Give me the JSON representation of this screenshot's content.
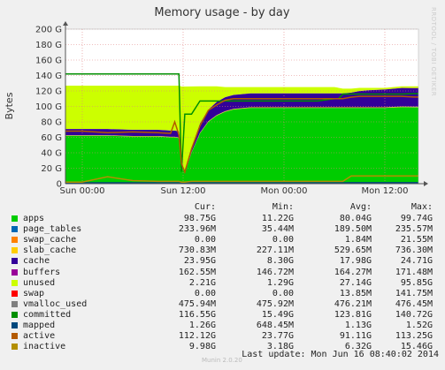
{
  "chart_data": {
    "type": "area",
    "title": "Memory usage - by day",
    "ylabel": "Bytes",
    "xlabel": "",
    "ylim": [
      0,
      200
    ],
    "y_unit": "G",
    "y_ticks": [
      "0",
      "20 G",
      "40 G",
      "60 G",
      "80 G",
      "100 G",
      "120 G",
      "140 G",
      "160 G",
      "180 G",
      "200 G"
    ],
    "x_ticks": [
      {
        "label": "Sun 00:00",
        "hour": 0
      },
      {
        "label": "Sun 12:00",
        "hour": 12
      },
      {
        "label": "Mon 00:00",
        "hour": 24
      },
      {
        "label": "Mon 12:00",
        "hour": 36
      }
    ],
    "x_range_hours": [
      -2,
      40
    ],
    "grid": true,
    "x": [
      -2,
      0,
      3,
      6,
      9,
      10.5,
      11,
      11.5,
      11.8,
      12.2,
      13,
      14,
      15,
      16,
      17,
      18,
      20,
      22,
      24,
      26,
      28,
      30,
      30.5,
      31,
      32,
      33,
      34,
      36,
      38,
      39.5,
      40
    ],
    "series": [
      {
        "name": "apps",
        "color": "#00cc00",
        "kind": "area",
        "values": [
          62,
          62,
          62,
          61,
          61,
          60,
          60,
          59,
          25,
          13,
          40,
          65,
          80,
          88,
          93,
          96,
          98,
          98,
          98,
          98,
          98,
          98,
          98,
          98,
          98,
          98,
          98,
          98,
          99,
          98.75,
          98.75
        ]
      },
      {
        "name": "page_tables",
        "color": "#0066b3",
        "kind": "area",
        "values": [
          0.2,
          0.2,
          0.2,
          0.2,
          0.2,
          0.2,
          0.2,
          0.2,
          0.2,
          0.2,
          0.2,
          0.2,
          0.2,
          0.2,
          0.2,
          0.2,
          0.2,
          0.2,
          0.2,
          0.2,
          0.2,
          0.2,
          0.2,
          0.2,
          0.2,
          0.2,
          0.2,
          0.2,
          0.2,
          0.2,
          0.2
        ]
      },
      {
        "name": "swap_cache",
        "color": "#ff8000",
        "kind": "area",
        "values": [
          0,
          0,
          0,
          0,
          0,
          0,
          0,
          0,
          0,
          0,
          0,
          0,
          0,
          0,
          0,
          0,
          0,
          0,
          0,
          0,
          0,
          0,
          0,
          0,
          0,
          0,
          0,
          0,
          0,
          0,
          0
        ]
      },
      {
        "name": "slab_cache",
        "color": "#ffcc00",
        "kind": "area",
        "values": [
          0.5,
          0.5,
          0.5,
          0.5,
          0.5,
          0.5,
          0.5,
          0.5,
          0.4,
          0.3,
          0.5,
          0.6,
          0.7,
          0.7,
          0.7,
          0.7,
          0.7,
          0.7,
          0.7,
          0.7,
          0.7,
          0.7,
          0.7,
          0.7,
          0.7,
          0.7,
          0.7,
          0.7,
          0.7,
          0.73,
          0.73
        ]
      },
      {
        "name": "cache",
        "color": "#330099",
        "kind": "area",
        "values": [
          8,
          8,
          8,
          8,
          8,
          8,
          8,
          8,
          4,
          2,
          6,
          12,
          15,
          17,
          18,
          18,
          18,
          18,
          18,
          18,
          18,
          18,
          18,
          18,
          19,
          21,
          22,
          23,
          24,
          23.95,
          23.95
        ]
      },
      {
        "name": "buffers",
        "color": "#990099",
        "kind": "area",
        "values": [
          0.17,
          0.17,
          0.17,
          0.17,
          0.17,
          0.17,
          0.17,
          0.17,
          0.15,
          0.15,
          0.16,
          0.17,
          0.17,
          0.17,
          0.17,
          0.17,
          0.17,
          0.17,
          0.17,
          0.17,
          0.17,
          0.17,
          0.17,
          0.17,
          0.17,
          0.17,
          0.17,
          0.17,
          0.17,
          0.16,
          0.16
        ]
      },
      {
        "name": "unused",
        "color": "#ccff00",
        "kind": "area",
        "values": [
          56,
          56,
          56,
          57,
          57,
          58,
          58,
          59,
          96,
          110,
          79,
          48,
          30,
          20,
          13,
          10,
          8,
          8,
          8,
          8,
          8,
          8,
          7,
          6,
          5,
          4,
          3,
          2,
          2,
          2.21,
          2.21
        ]
      },
      {
        "name": "swap",
        "color": "#ff0000",
        "kind": "area",
        "values": [
          0,
          0,
          0,
          0,
          0,
          0,
          0,
          0,
          0,
          0,
          0,
          0,
          0,
          0,
          0,
          0,
          0,
          0,
          0,
          0,
          0,
          0,
          0,
          0,
          0,
          0,
          0,
          0,
          0,
          0,
          0
        ]
      },
      {
        "name": "vmalloc_used",
        "color": "#808080",
        "kind": "line",
        "values": [
          0.48,
          0.48,
          0.48,
          0.48,
          0.48,
          0.48,
          0.48,
          0.48,
          0.48,
          0.48,
          0.48,
          0.48,
          0.48,
          0.48,
          0.48,
          0.48,
          0.48,
          0.48,
          0.48,
          0.48,
          0.48,
          0.48,
          0.48,
          0.48,
          0.48,
          0.48,
          0.48,
          0.48,
          0.48,
          0.48,
          0.48
        ]
      },
      {
        "name": "committed",
        "color": "#008f00",
        "kind": "line",
        "values": [
          142,
          142,
          142,
          142,
          142,
          142,
          142,
          142,
          15.5,
          90,
          90,
          107,
          107,
          107,
          107,
          107,
          107,
          107,
          107,
          107,
          107,
          110,
          110,
          116,
          116,
          116,
          116,
          116,
          116,
          116.55,
          116.55
        ]
      },
      {
        "name": "mapped",
        "color": "#00487d",
        "kind": "line",
        "values": [
          1.2,
          1.2,
          1.2,
          1.2,
          1.2,
          1.2,
          1.2,
          1.2,
          1.1,
          1.1,
          1.2,
          1.2,
          1.2,
          1.2,
          1.2,
          1.2,
          1.2,
          1.2,
          1.2,
          1.2,
          1.2,
          1.2,
          1.2,
          1.2,
          1.3,
          1.3,
          1.3,
          1.3,
          1.3,
          1.26,
          1.26
        ]
      },
      {
        "name": "active",
        "color": "#b35a00",
        "kind": "line",
        "values": [
          68,
          68,
          66,
          67,
          66,
          65,
          80,
          63,
          26,
          15,
          45,
          75,
          95,
          102,
          108,
          110,
          110,
          110,
          110,
          110,
          110,
          110,
          110,
          110,
          112,
          113,
          113,
          113,
          113,
          112.12,
          112.12
        ]
      },
      {
        "name": "inactive",
        "color": "#b38f00",
        "kind": "line",
        "values": [
          2,
          2,
          9,
          4,
          3,
          3,
          3,
          3,
          2,
          2,
          3,
          3,
          3,
          3,
          3,
          3,
          3,
          3,
          3,
          3,
          3,
          3,
          3,
          3,
          10,
          10,
          10,
          10,
          10,
          9.98,
          9.98
        ]
      }
    ]
  },
  "legend": {
    "headers": {
      "cur": "Cur:",
      "min": "Min:",
      "avg": "Avg:",
      "max": "Max:"
    },
    "rows": [
      {
        "name": "apps",
        "color": "#00cc00",
        "cur": "98.75G",
        "min": "11.22G",
        "avg": "80.04G",
        "max": "99.74G"
      },
      {
        "name": "page_tables",
        "color": "#0066b3",
        "cur": "233.96M",
        "min": "35.44M",
        "avg": "189.50M",
        "max": "235.57M"
      },
      {
        "name": "swap_cache",
        "color": "#ff8000",
        "cur": "0.00",
        "min": "0.00",
        "avg": "1.84M",
        "max": "21.55M"
      },
      {
        "name": "slab_cache",
        "color": "#ffcc00",
        "cur": "730.83M",
        "min": "227.11M",
        "avg": "529.65M",
        "max": "736.30M"
      },
      {
        "name": "cache",
        "color": "#330099",
        "cur": "23.95G",
        "min": "8.30G",
        "avg": "17.98G",
        "max": "24.71G"
      },
      {
        "name": "buffers",
        "color": "#990099",
        "cur": "162.55M",
        "min": "146.72M",
        "avg": "164.27M",
        "max": "171.48M"
      },
      {
        "name": "unused",
        "color": "#ccff00",
        "cur": "2.21G",
        "min": "1.29G",
        "avg": "27.14G",
        "max": "95.85G"
      },
      {
        "name": "swap",
        "color": "#ff0000",
        "cur": "0.00",
        "min": "0.00",
        "avg": "13.85M",
        "max": "141.75M"
      },
      {
        "name": "vmalloc_used",
        "color": "#808080",
        "cur": "475.94M",
        "min": "475.92M",
        "avg": "476.21M",
        "max": "476.45M"
      },
      {
        "name": "committed",
        "color": "#008f00",
        "cur": "116.55G",
        "min": "15.49G",
        "avg": "123.81G",
        "max": "140.72G"
      },
      {
        "name": "mapped",
        "color": "#00487d",
        "cur": "1.26G",
        "min": "648.45M",
        "avg": "1.13G",
        "max": "1.52G"
      },
      {
        "name": "active",
        "color": "#b35a00",
        "cur": "112.12G",
        "min": "23.77G",
        "avg": "91.11G",
        "max": "113.25G"
      },
      {
        "name": "inactive",
        "color": "#b38f00",
        "cur": "9.98G",
        "min": "3.18G",
        "avg": "6.32G",
        "max": "15.46G"
      }
    ]
  },
  "footer": {
    "last_update": "Last update:  Mon Jun 16 08:40:02 2014",
    "version": "Munin 2.0.20"
  },
  "watermark": "RRDTOOL / TOBI OETIKER"
}
